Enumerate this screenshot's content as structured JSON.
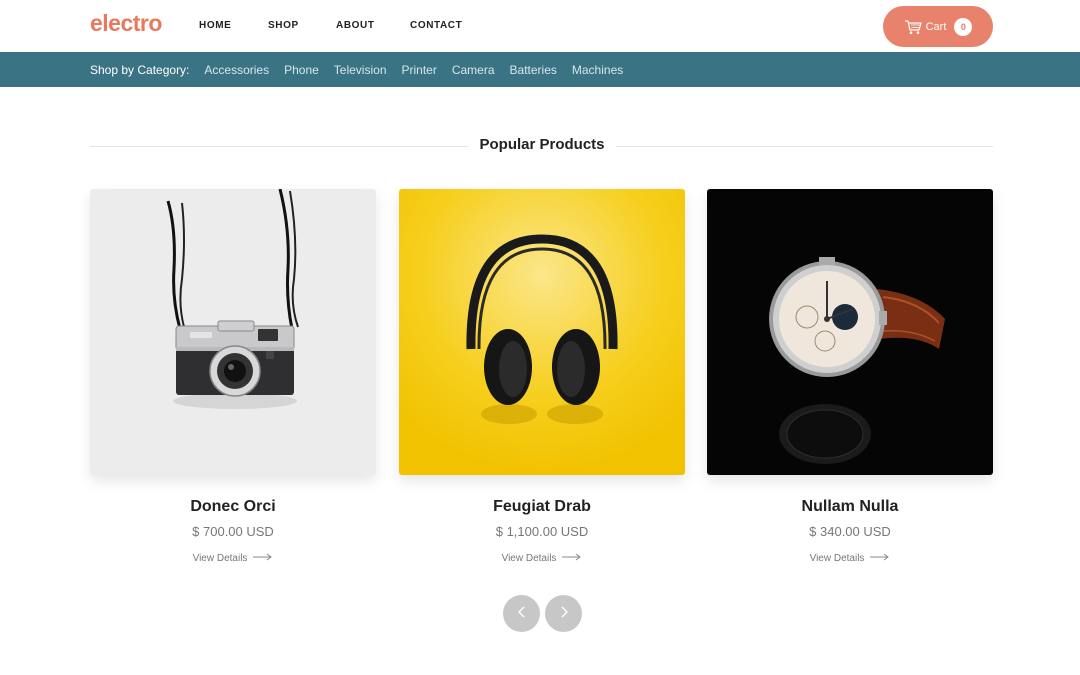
{
  "brand": {
    "logo": "electro",
    "accent": "#e8795f",
    "bar_color": "#3a7384"
  },
  "nav": {
    "items": [
      {
        "label": "HOME"
      },
      {
        "label": "SHOP"
      },
      {
        "label": "ABOUT"
      },
      {
        "label": "CONTACT"
      }
    ]
  },
  "cart": {
    "icon": "cart-icon",
    "label": "Cart",
    "count": "0"
  },
  "category_bar": {
    "title": "Shop by Category:",
    "items": [
      "Accessories",
      "Phone",
      "Television",
      "Printer",
      "Camera",
      "Batteries",
      "Machines"
    ]
  },
  "section": {
    "title": "Popular Products"
  },
  "products": [
    {
      "name": "Donec Orci",
      "price": "$ 700.00 USD",
      "details_label": "View Details",
      "image": "camera-image"
    },
    {
      "name": "Feugiat Drab",
      "price": "$ 1,100.00 USD",
      "details_label": "View Details",
      "image": "headphones-image"
    },
    {
      "name": "Nullam Nulla",
      "price": "$ 340.00 USD",
      "details_label": "View Details",
      "image": "watch-image"
    }
  ],
  "pager": {
    "prev_icon": "chevron-left-icon",
    "next_icon": "chevron-right-icon"
  }
}
